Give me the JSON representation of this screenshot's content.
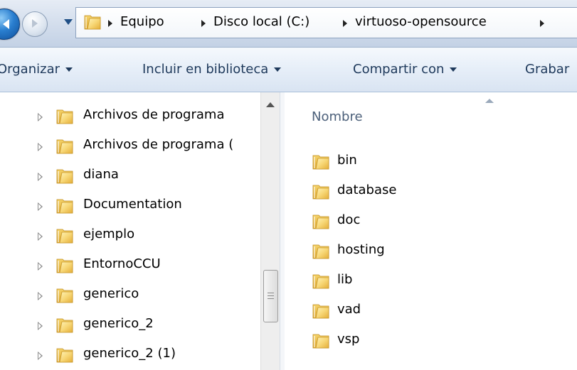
{
  "address_bar": {
    "breadcrumbs": [
      "Equipo",
      "Disco local (C:)",
      "virtuoso-opensource"
    ]
  },
  "command_bar": {
    "items": [
      {
        "label": "Organizar"
      },
      {
        "label": "Incluir en biblioteca"
      },
      {
        "label": "Compartir con"
      },
      {
        "label": "Grabar"
      }
    ]
  },
  "nav_pane": {
    "items": [
      {
        "label": "Archivos de programa"
      },
      {
        "label": "Archivos de programa ("
      },
      {
        "label": "diana"
      },
      {
        "label": "Documentation"
      },
      {
        "label": "ejemplo"
      },
      {
        "label": "EntornoCCU"
      },
      {
        "label": "generico"
      },
      {
        "label": "generico_2"
      },
      {
        "label": "generico_2 (1)"
      }
    ]
  },
  "content": {
    "column_header": "Nombre",
    "files": [
      {
        "label": "bin"
      },
      {
        "label": "database"
      },
      {
        "label": "doc"
      },
      {
        "label": "hosting"
      },
      {
        "label": "lib"
      },
      {
        "label": "vad"
      },
      {
        "label": "vsp"
      }
    ]
  },
  "colors": {
    "folder_yellow": "#f2c84b",
    "command_text": "#1e395b",
    "header_text": "#4c607a"
  }
}
